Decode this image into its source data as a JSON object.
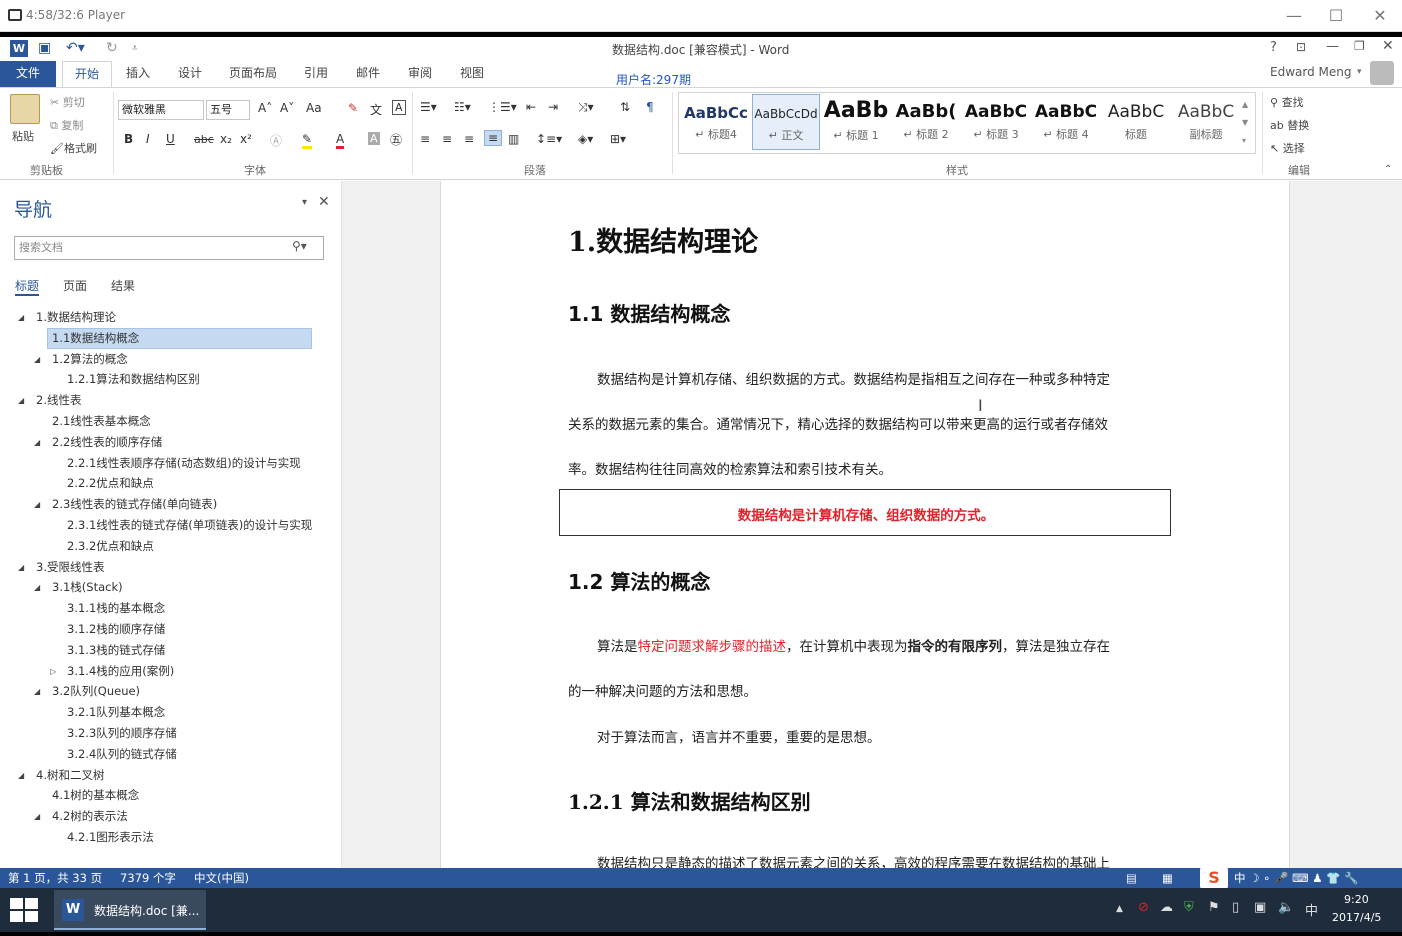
{
  "player": {
    "title": "4:58/32:6 Player"
  },
  "word": {
    "doc_title": "数据结构.doc [兼容模式] - Word",
    "username_label": "用户名:297期",
    "account": "Edward Meng",
    "help": "?",
    "tabs": [
      "文件",
      "开始",
      "插入",
      "设计",
      "页面布局",
      "引用",
      "邮件",
      "审阅",
      "视图"
    ]
  },
  "ribbon": {
    "clipboard": {
      "paste": "粘贴",
      "cut": "剪切",
      "copy": "复制",
      "format_painter": "格式刷",
      "label": "剪贴板"
    },
    "font": {
      "name": "微软雅黑",
      "size": "五号",
      "label": "字体",
      "bold": "B",
      "italic": "I",
      "underline": "U",
      "strike": "abc",
      "sub": "x₂",
      "sup": "x²",
      "grow": "A˄",
      "shrink": "A˅",
      "case": "Aa",
      "color_a": "A"
    },
    "paragraph": {
      "label": "段落"
    },
    "styles": {
      "label": "样式",
      "items": [
        {
          "sample": "AaBbCc",
          "name": "↵ 标题4"
        },
        {
          "sample": "AaBbCcDd",
          "name": "↵ 正文"
        },
        {
          "sample": "AaBb",
          "name": "↵ 标题 1"
        },
        {
          "sample": "AaBb(",
          "name": "↵ 标题 2"
        },
        {
          "sample": "AaBbC",
          "name": "↵ 标题 3"
        },
        {
          "sample": "AaBbC",
          "name": "↵ 标题 4"
        },
        {
          "sample": "AaBbC",
          "name": "标题"
        },
        {
          "sample": "AaBbC",
          "name": "副标题"
        }
      ]
    },
    "editing": {
      "find": "查找",
      "replace": "替换",
      "select": "选择",
      "label": "编辑"
    }
  },
  "nav": {
    "title": "导航",
    "search_placeholder": "搜索文档",
    "tabs": [
      "标题",
      "页面",
      "结果"
    ],
    "tree": [
      {
        "label": "1.数据结构理论",
        "level": 1,
        "expanded": true
      },
      {
        "label": "1.1数据结构概念",
        "level": 2,
        "selected": true
      },
      {
        "label": "1.2算法的概念",
        "level": 2,
        "expanded": true
      },
      {
        "label": "1.2.1算法和数据结构区别",
        "level": 3
      },
      {
        "label": "2.线性表",
        "level": 1,
        "expanded": true
      },
      {
        "label": "2.1线性表基本概念",
        "level": 2
      },
      {
        "label": "2.2线性表的顺序存储",
        "level": 2,
        "expanded": true
      },
      {
        "label": "2.2.1线性表顺序存储(动态数组)的设计与实现",
        "level": 3
      },
      {
        "label": "2.2.2优点和缺点",
        "level": 3
      },
      {
        "label": "2.3线性表的链式存储(单向链表)",
        "level": 2,
        "expanded": true
      },
      {
        "label": "2.3.1线性表的链式存储(单项链表)的设计与实现",
        "level": 3
      },
      {
        "label": "2.3.2优点和缺点",
        "level": 3
      },
      {
        "label": "3.受限线性表",
        "level": 1,
        "expanded": true
      },
      {
        "label": "3.1栈(Stack)",
        "level": 2,
        "expanded": true
      },
      {
        "label": "3.1.1栈的基本概念",
        "level": 3
      },
      {
        "label": "3.1.2栈的顺序存储",
        "level": 3
      },
      {
        "label": "3.1.3栈的链式存储",
        "level": 3
      },
      {
        "label": "3.1.4栈的应用(案例)",
        "level": 3,
        "collapsed": true
      },
      {
        "label": "3.2队列(Queue)",
        "level": 2,
        "expanded": true
      },
      {
        "label": "3.2.1队列基本概念",
        "level": 3
      },
      {
        "label": "3.2.3队列的顺序存储",
        "level": 3
      },
      {
        "label": "3.2.4队列的链式存储",
        "level": 3
      },
      {
        "label": "4.树和二叉树",
        "level": 1,
        "expanded": true
      },
      {
        "label": "4.1树的基本概念",
        "level": 2
      },
      {
        "label": "4.2树的表示法",
        "level": 2,
        "expanded": true
      },
      {
        "label": "4.2.1图形表示法",
        "level": 3
      }
    ]
  },
  "document": {
    "h1": "1.数据结构理论",
    "h1_1": "1.1 数据结构概念",
    "p1_line1": "数据结构是计算机存储、组织数据的方式。数据结构是指相互之间存在一种或多种特定",
    "p1_line2": "关系的数据元素的集合。通常情况下，精心选择的数据结构可以带来更高的运行或者存储效",
    "p1_line3": "率。数据结构往往同高效的检索算法和索引技术有关。",
    "callout": "数据结构是计算机存储、组织数据的方式。",
    "h1_2": "1.2 算法的概念",
    "p2_a": "算法是",
    "p2_red": "特定问题求解步骤的描述",
    "p2_b": "，在计算机中表现为",
    "p2_bold": "指令的有限序列",
    "p2_c": "，算法是独立存在",
    "p2_line2": "的一种解决问题的方法和思想。",
    "p3": "对于算法而言，语言并不重要，重要的是思想。",
    "h1_2_1": "1.2.1 算法和数据结构区别",
    "p4": "数据结构只是静态的描述了数据元素之间的关系，高效的程序需要在数据结构的基础上"
  },
  "status": {
    "page": "第 1 页，共 33 页",
    "words": "7379 个字",
    "lang": "中文(中国)"
  },
  "taskbar": {
    "task_label": "数据结构.doc [兼...",
    "time": "9:20",
    "date": "2017/4/5",
    "ime": "中"
  },
  "colors": {
    "accent": "#2b579a",
    "red": "#e2222a",
    "selection": "#c5daf1",
    "taskbar": "#1e2c3c"
  }
}
